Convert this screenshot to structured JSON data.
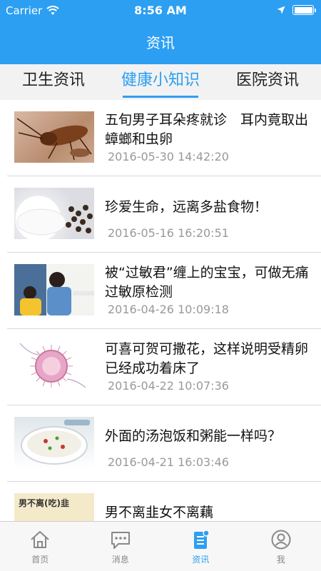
{
  "status_bar": {
    "carrier": "Carrier",
    "time": "8:56 AM"
  },
  "nav": {
    "title": "资讯"
  },
  "tabs": [
    {
      "label": "卫生资讯",
      "active": false
    },
    {
      "label": "健康小知识",
      "active": true
    },
    {
      "label": "医院资讯",
      "active": false
    }
  ],
  "articles": [
    {
      "title": "五旬男子耳朵疼就诊　耳内竟取出蟑螂和虫卵",
      "date": "2016-05-30 14:42:20",
      "thumb_icon": "cockroach-image"
    },
    {
      "title": "珍爱生命，远离多盐食物！",
      "date": "2016-05-16 16:20:51",
      "thumb_icon": "salt-pepper-image"
    },
    {
      "title": "被“过敏君”缠上的宝宝，可做无痛过敏原检测",
      "date": "2016-04-26 10:09:18",
      "thumb_icon": "child-allergy-test-image"
    },
    {
      "title": "可喜可贺可撒花，这样说明受精卵已经成功着床了",
      "date": "2016-04-22 10:07:36",
      "thumb_icon": "embryo-image"
    },
    {
      "title": "外面的汤泡饭和粥能一样吗？",
      "date": "2016-04-21 16:03:46",
      "thumb_icon": "porridge-bowl-image"
    },
    {
      "title": "男不离韭女不离藕",
      "date": "",
      "thumb_icon": "text-graphic-image",
      "thumb_text": "男不离(吃)韭"
    }
  ],
  "tabbar": [
    {
      "label": "首页",
      "icon": "home-icon",
      "active": false
    },
    {
      "label": "消息",
      "icon": "message-icon",
      "active": false
    },
    {
      "label": "资讯",
      "icon": "news-icon",
      "active": true
    },
    {
      "label": "我",
      "icon": "profile-icon",
      "active": false
    }
  ],
  "colors": {
    "accent": "#2c9ff2",
    "date_text": "#999999",
    "divider": "#d9d9d9"
  }
}
